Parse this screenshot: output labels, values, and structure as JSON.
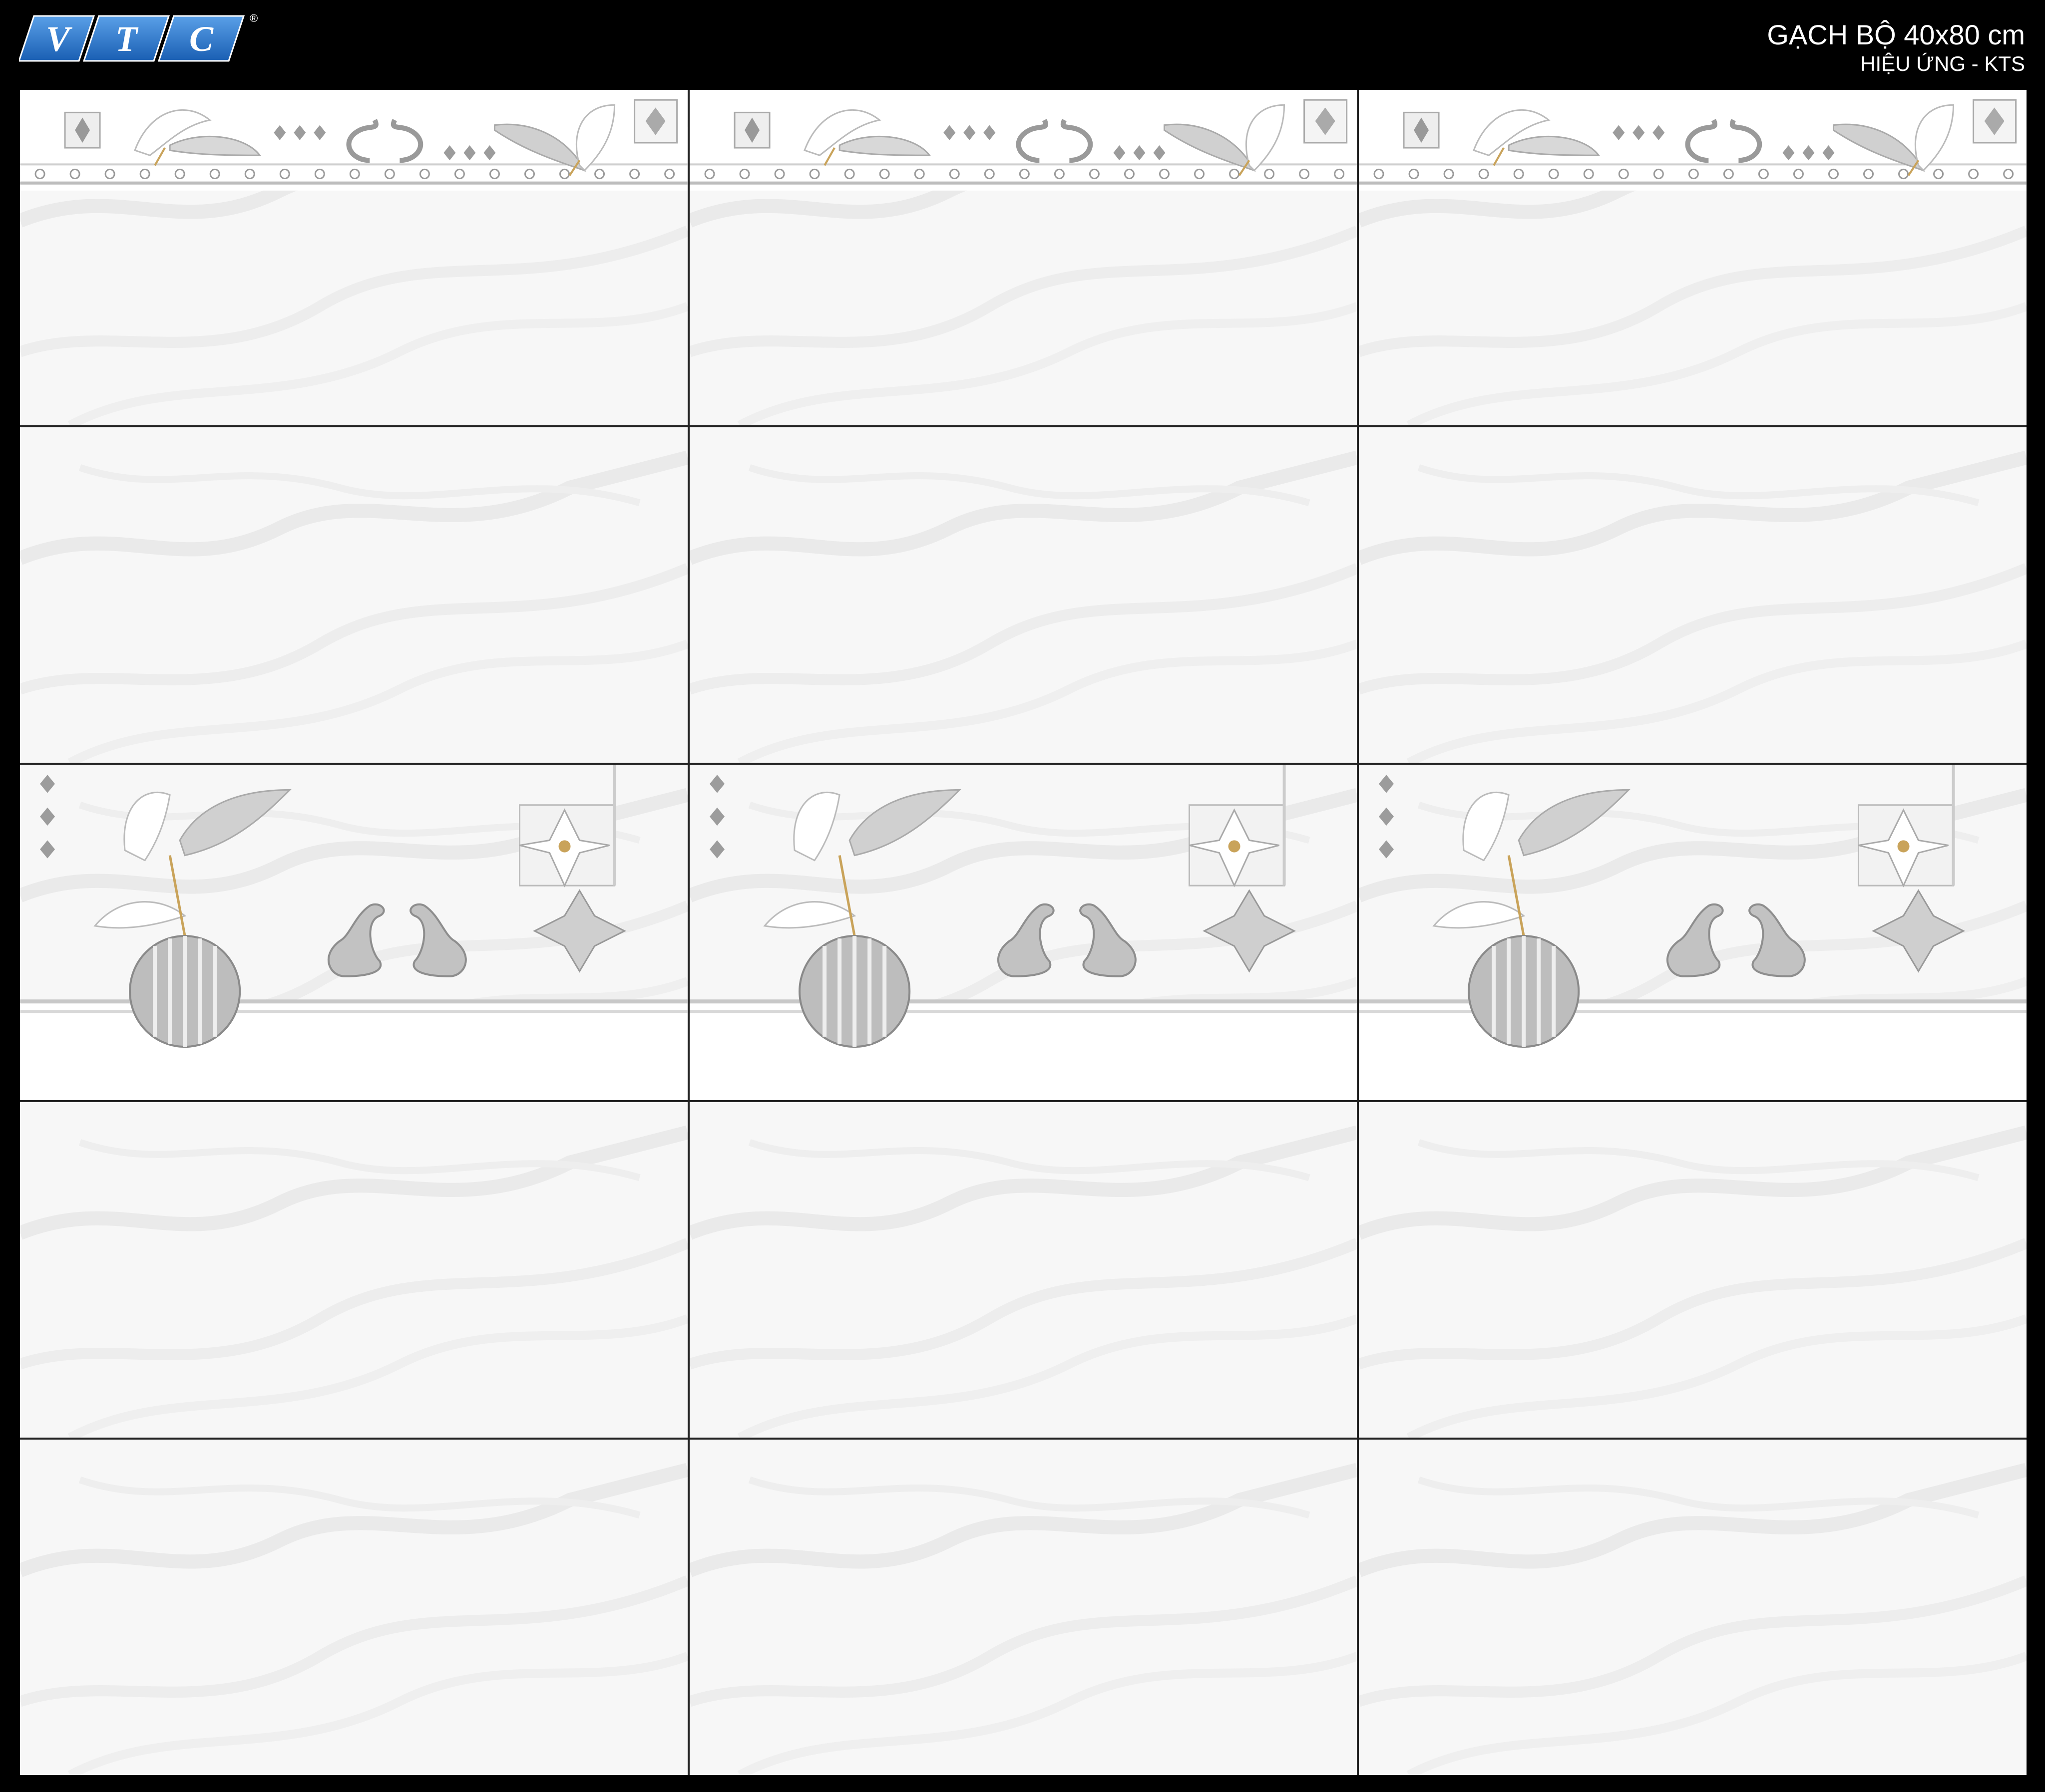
{
  "brand": {
    "logo_text": "VTC",
    "registered_mark": "®",
    "logo_color": "#1f6fc0",
    "icon": "vtc-logo-icon"
  },
  "header": {
    "title": "GẠCH BỘ 40x80 cm",
    "subtitle": "HIỆU ỨNG - KTS"
  },
  "colors": {
    "background": "#000000",
    "tile_base": "#f7f7f7",
    "vein": "#e6e6e6",
    "silver": "#b5b5b5",
    "gold_stamen": "#c9a35a"
  },
  "board": {
    "columns": 3,
    "rows": [
      {
        "kind": "border-decor",
        "icons": [
          "lily-icon",
          "swan-pair-icon",
          "diamond-ornament-icon",
          "square-flower-icon"
        ]
      },
      {
        "kind": "plain"
      },
      {
        "kind": "feature-decor",
        "icons": [
          "lily-vase-icon",
          "swan-pair-icon",
          "magnolia-frame-icon",
          "clover-ornament-icon"
        ]
      },
      {
        "kind": "plain"
      },
      {
        "kind": "plain"
      }
    ]
  }
}
